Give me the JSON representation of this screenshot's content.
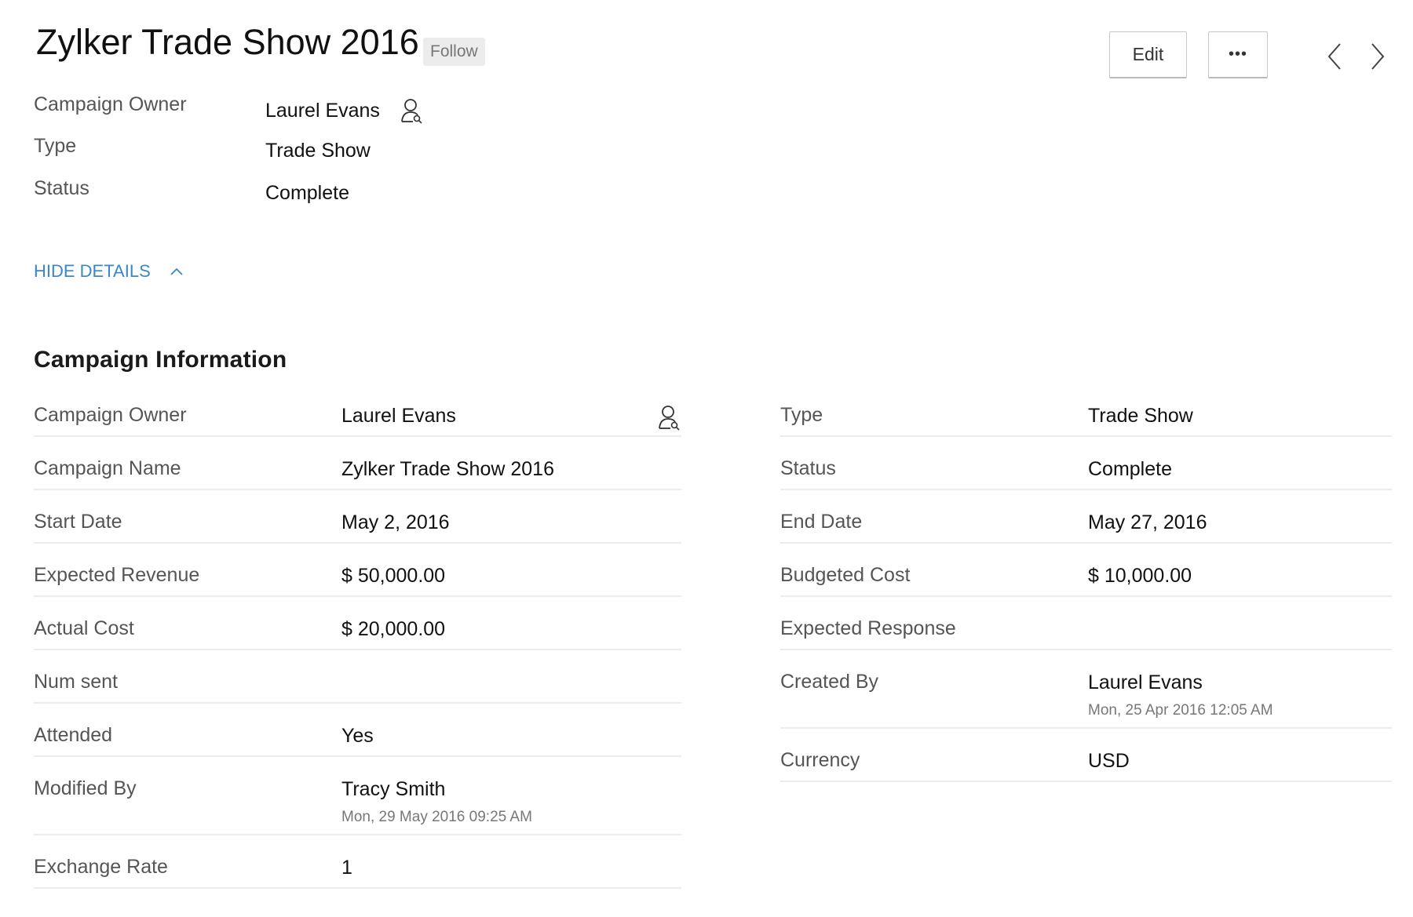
{
  "header": {
    "title": "Zylker Trade Show 2016",
    "follow": "Follow",
    "edit": "Edit",
    "more": "•••"
  },
  "summary": [
    {
      "label": "Campaign Owner",
      "value": "Laurel Evans"
    },
    {
      "label": "Type",
      "value": "Trade Show"
    },
    {
      "label": "Status",
      "value": "Complete"
    }
  ],
  "hide_details": "HIDE DETAILS",
  "section_title": "Campaign Information",
  "left": [
    {
      "label": "Campaign Owner",
      "value": "Laurel Evans"
    },
    {
      "label": "Campaign Name",
      "value": "Zylker Trade Show 2016"
    },
    {
      "label": "Start Date",
      "value": "May 2, 2016"
    },
    {
      "label": "Expected Revenue",
      "value": "$ 50,000.00"
    },
    {
      "label": "Actual Cost",
      "value": "$ 20,000.00"
    },
    {
      "label": "Num sent",
      "value": ""
    },
    {
      "label": "Attended",
      "value": "Yes"
    },
    {
      "label": "Modified By",
      "value": "Tracy Smith",
      "sub": "Mon, 29 May 2016 09:25 AM"
    },
    {
      "label": "Exchange Rate",
      "value": "1"
    }
  ],
  "right": [
    {
      "label": "Type",
      "value": "Trade Show"
    },
    {
      "label": "Status",
      "value": "Complete"
    },
    {
      "label": "End Date",
      "value": "May 27, 2016"
    },
    {
      "label": "Budgeted Cost",
      "value": "$ 10,000.00"
    },
    {
      "label": "Expected Response",
      "value": ""
    },
    {
      "label": "Created By",
      "value": "Laurel Evans",
      "sub": "Mon, 25 Apr 2016 12:05 AM"
    },
    {
      "label": "Currency",
      "value": "USD"
    }
  ]
}
